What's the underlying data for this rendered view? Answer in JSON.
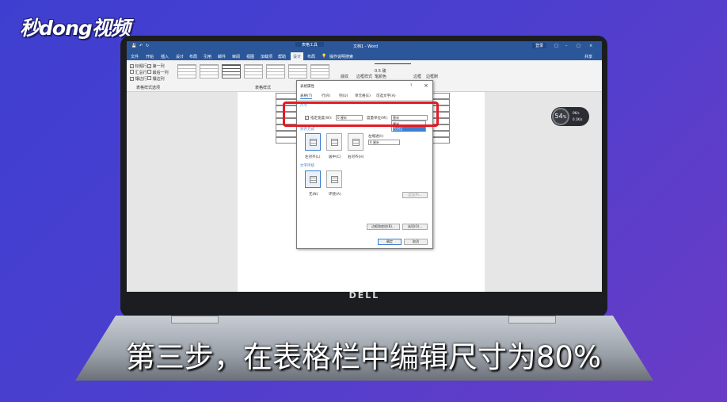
{
  "logo": "秒dong视频",
  "caption": "第三步，在表格栏中编辑尺寸为80%",
  "laptop_brand": "DELL",
  "word": {
    "context_tab": "表格工具",
    "doc_title": "文档1 - Word",
    "signin": "登录",
    "menu": [
      "文件",
      "开始",
      "插入",
      "设计",
      "布局",
      "引用",
      "邮件",
      "审阅",
      "视图",
      "加载项",
      "帮助",
      "设计",
      "布局"
    ],
    "active_menu_index": 11,
    "tell_me": "操作说明搜索",
    "share": "共享",
    "ribbon_checks": [
      {
        "label": "标题行",
        "checked": true
      },
      {
        "label": "第一列",
        "checked": true
      },
      {
        "label": "汇总行",
        "checked": false
      },
      {
        "label": "最后一列",
        "checked": false
      },
      {
        "label": "镶边行",
        "checked": true
      },
      {
        "label": "镶边列",
        "checked": false
      }
    ],
    "ribbon_group1": "表格样式选项",
    "ribbon_group2": "表格样式",
    "ribbon_shading": "底纹",
    "ribbon_border_styles": "边框样式",
    "ribbon_pen_weight": "0.5 磅",
    "ribbon_pen_color": "笔颜色",
    "ribbon_borders": "边框",
    "ribbon_painter": "边框刷"
  },
  "dialog": {
    "title": "表格属性",
    "help": "?",
    "close": "×",
    "tabs": [
      "表格(T)",
      "行(R)",
      "列(U)",
      "单元格(E)",
      "可选文字(A)"
    ],
    "size_label": "尺寸",
    "pref_width_label": "指定宽度(W):",
    "pref_width_value": "0 厘米",
    "measure_label": "度量单位(M):",
    "measure_value": "厘米",
    "dropdown_options": [
      "厘米",
      "百分比"
    ],
    "align_label": "对齐方式",
    "align_options": [
      "左对齐(L)",
      "居中(C)",
      "右对齐(H)"
    ],
    "indent_label": "左缩进(I):",
    "indent_value": "0 厘米",
    "wrap_label": "文字环绕",
    "wrap_options": [
      "无(N)",
      "环绕(A)"
    ],
    "position_button": "定位(P)...",
    "borders_button": "边框和底纹(B)...",
    "options_button": "选项(O)...",
    "ok_button": "确定",
    "cancel_button": "取消"
  },
  "gauge": {
    "value": "54",
    "unit": "%",
    "up": "0K/s",
    "down": "0.1K/s"
  }
}
